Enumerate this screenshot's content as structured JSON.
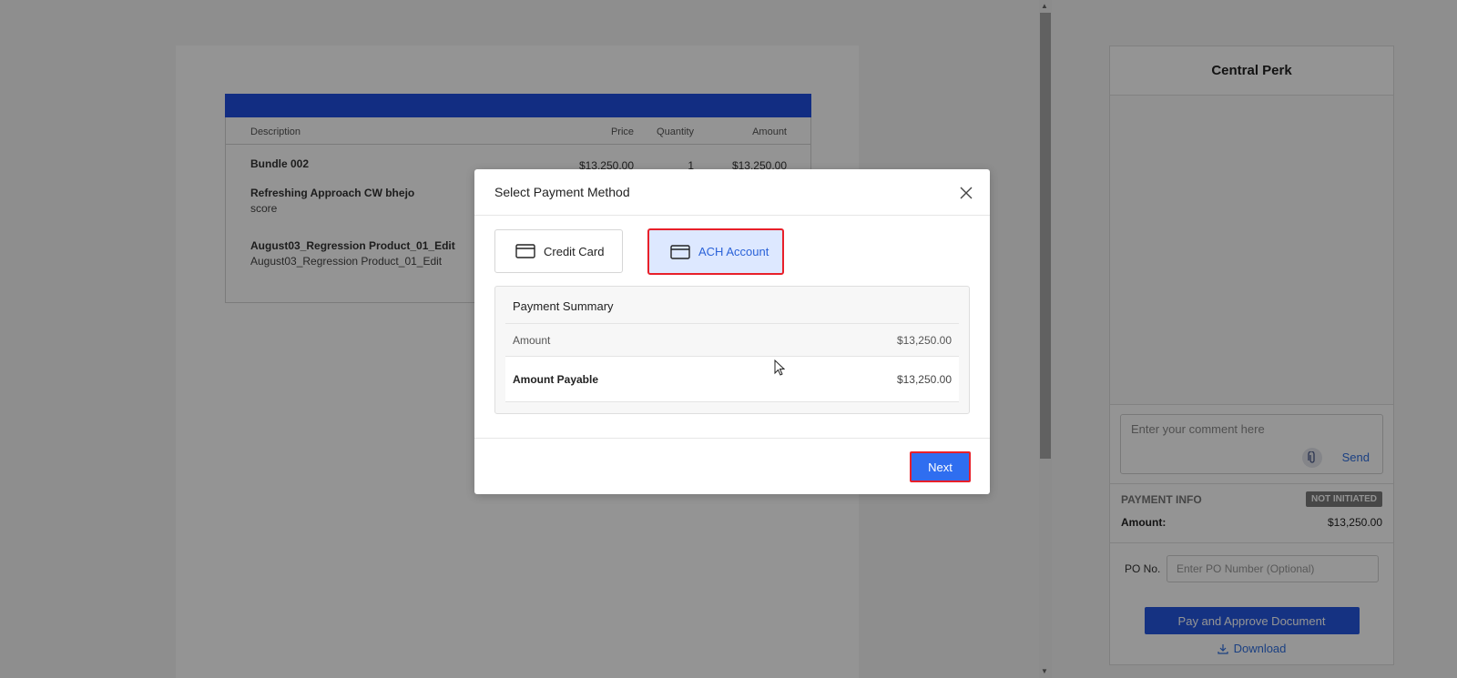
{
  "document": {
    "columns": {
      "description": "Description",
      "price": "Price",
      "quantity": "Quantity",
      "amount": "Amount"
    },
    "items": [
      {
        "title": "Bundle 002",
        "sub": "",
        "price": "$13,250.00",
        "qty": "1",
        "amount": "$13,250.00"
      },
      {
        "title": "Refreshing Approach CW bhejo",
        "sub": "score"
      },
      {
        "title": "August03_Regression Product_01_Edit",
        "sub": "August03_Regression Product_01_Edit"
      }
    ]
  },
  "sidebar": {
    "title": "Central Perk",
    "comment_placeholder": "Enter your comment here",
    "send_label": "Send",
    "payment_info": {
      "title": "PAYMENT INFO",
      "status": "NOT INITIATED",
      "amount_label": "Amount:",
      "amount_value": "$13,250.00"
    },
    "po_label": "PO No.",
    "po_placeholder": "Enter PO Number (Optional)",
    "approve_label": "Pay and Approve Document",
    "download_label": "Download"
  },
  "modal": {
    "title": "Select Payment Method",
    "methods": [
      {
        "label": "Credit Card",
        "selected": false
      },
      {
        "label": "ACH Account",
        "selected": true
      }
    ],
    "summary": {
      "title": "Payment Summary",
      "amount_label": "Amount",
      "amount_value": "$13,250.00",
      "payable_label": "Amount Payable",
      "payable_value": "$13,250.00"
    },
    "next_label": "Next"
  },
  "colors": {
    "accent": "#2f6ef0",
    "header_bar": "#1f4fe0",
    "highlight": "#e8202a"
  }
}
